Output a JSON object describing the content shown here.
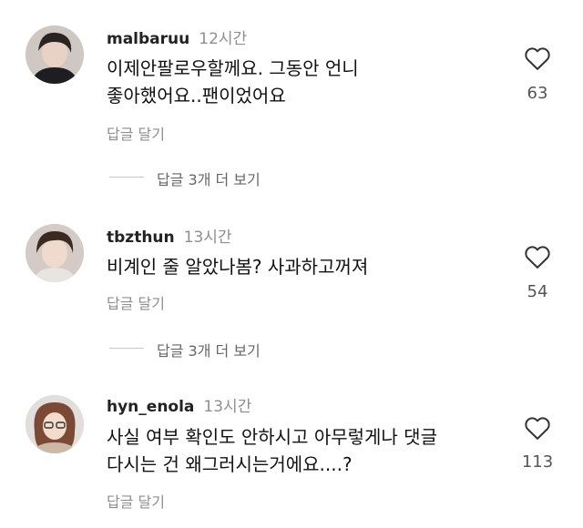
{
  "comments": [
    {
      "username": "malbaruu",
      "time": "12시간",
      "lines": [
        "이제안팔로우할께요. 그동안 언니",
        "좋아했어요..팬이었어요"
      ],
      "likes": "63",
      "reply_label": "답글 달기",
      "avatar_icon": "user-avatar-photo"
    },
    {
      "username": "tbzthun",
      "time": "13시간",
      "lines": [
        "비계인 줄 알았나봄? 사과하고꺼져"
      ],
      "likes": "54",
      "reply_label": "답글 달기",
      "avatar_icon": "user-avatar-photo"
    },
    {
      "username": "hyn_enola",
      "time": "13시간",
      "lines": [
        "사실 여부 확인도 안하시고 아무렇게나 댓글",
        "다시는 건 왜그러시는거에요....?"
      ],
      "likes": "113",
      "reply_label": "답글 달기",
      "avatar_icon": "user-avatar-photo"
    }
  ],
  "more_replies": [
    "답글 3개 더 보기",
    "답글 3개 더 보기"
  ],
  "icons": {
    "like": "heart-outline-icon"
  },
  "colors": {
    "meta_gray": "#8e8e8e",
    "text": "#111111"
  }
}
